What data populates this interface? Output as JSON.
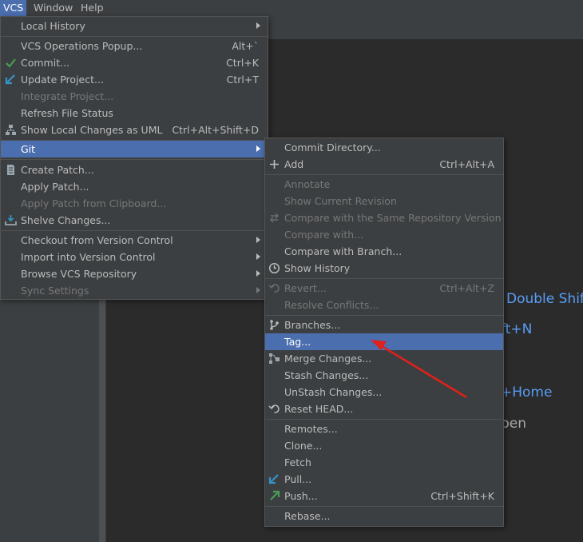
{
  "menubar": {
    "vcs": "VCS",
    "window": "Window",
    "help": "Help"
  },
  "hints": {
    "h1": "Double Shift",
    "h2": "ft+N",
    "h3": "+Home",
    "h4": "pen"
  },
  "vcs_menu": {
    "local_history": "Local History",
    "operations_popup": "VCS Operations Popup...",
    "operations_popup_sc": "Alt+`",
    "commit": "Commit...",
    "commit_sc": "Ctrl+K",
    "update_project": "Update Project...",
    "update_project_sc": "Ctrl+T",
    "integrate_project": "Integrate Project...",
    "refresh_status": "Refresh File Status",
    "show_local_changes_uml": "Show Local Changes as UML",
    "show_local_changes_uml_sc": "Ctrl+Alt+Shift+D",
    "git": "Git",
    "create_patch": "Create Patch...",
    "apply_patch": "Apply Patch...",
    "apply_patch_clipboard": "Apply Patch from Clipboard...",
    "shelve_changes": "Shelve Changes...",
    "checkout": "Checkout from Version Control",
    "import": "Import into Version Control",
    "browse_repo": "Browse VCS Repository",
    "sync_settings": "Sync Settings"
  },
  "git_menu": {
    "commit_directory": "Commit Directory...",
    "add": "Add",
    "add_sc": "Ctrl+Alt+A",
    "annotate": "Annotate",
    "show_current_revision": "Show Current Revision",
    "compare_same_repo": "Compare with the Same Repository Version",
    "compare_with": "Compare with...",
    "compare_branch": "Compare with Branch...",
    "show_history": "Show History",
    "revert": "Revert...",
    "revert_sc": "Ctrl+Alt+Z",
    "resolve_conflicts": "Resolve Conflicts...",
    "branches": "Branches...",
    "tag": "Tag...",
    "merge_changes": "Merge Changes...",
    "stash_changes": "Stash Changes...",
    "unstash_changes": "UnStash Changes...",
    "reset_head": "Reset HEAD...",
    "remotes": "Remotes...",
    "clone": "Clone...",
    "fetch": "Fetch",
    "pull": "Pull...",
    "push": "Push...",
    "push_sc": "Ctrl+Shift+K",
    "rebase": "Rebase..."
  },
  "colors": {
    "selection": "#4b6eaf",
    "annotation_arrow": "#e0201b",
    "hint_blue": "#589df6"
  }
}
